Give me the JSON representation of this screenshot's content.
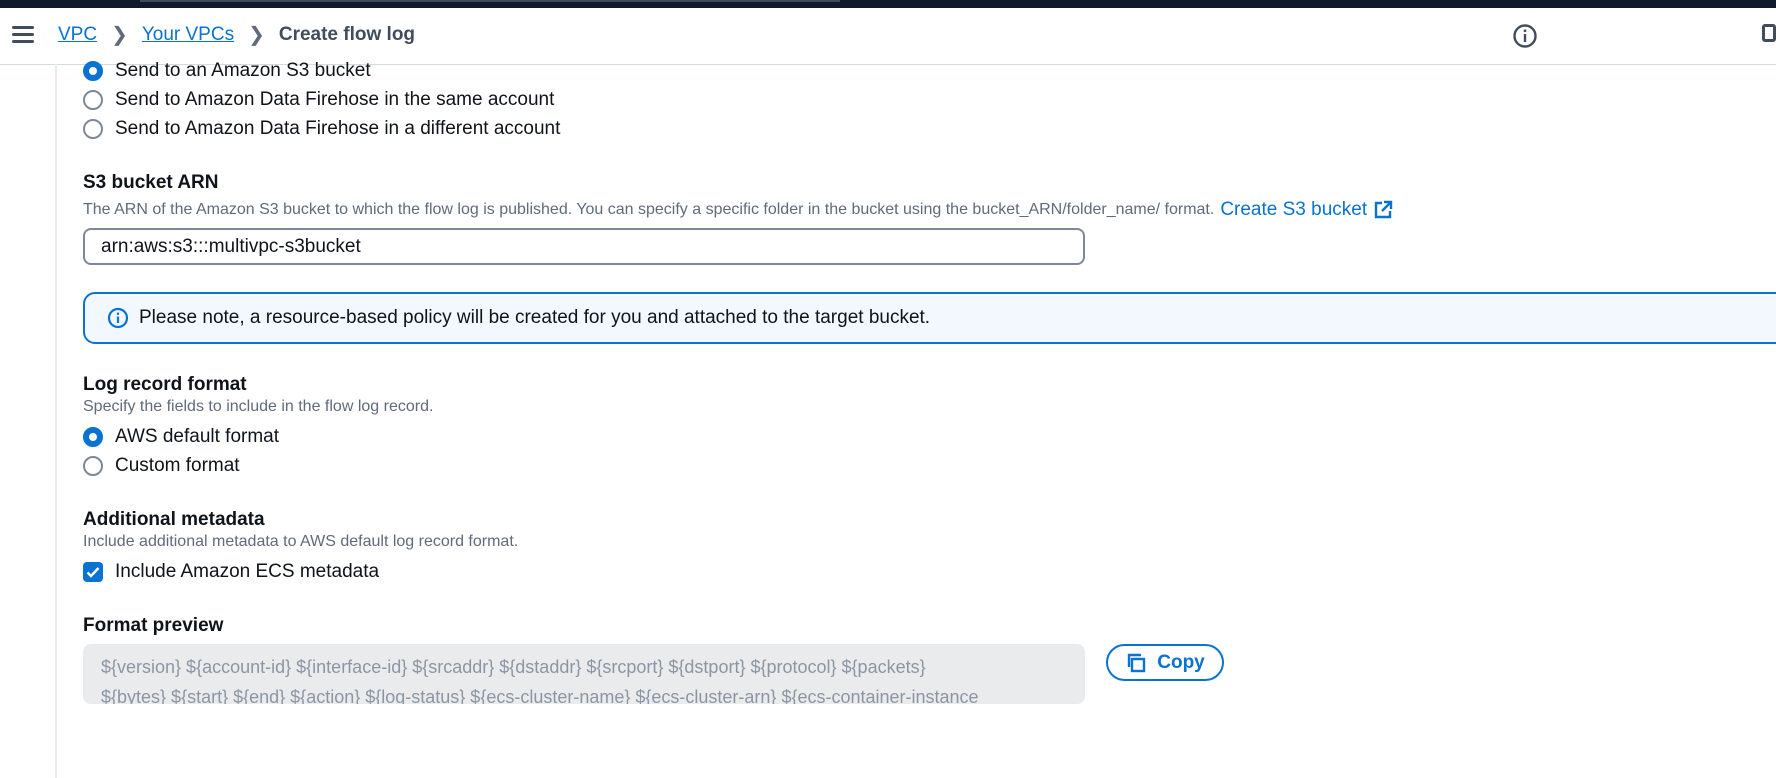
{
  "header": {
    "breadcrumb": [
      {
        "label": "VPC"
      },
      {
        "label": "Your VPCs"
      },
      {
        "label": "Create flow log"
      }
    ]
  },
  "destination": {
    "options": [
      {
        "label": "Send to an Amazon S3 bucket",
        "checked": true
      },
      {
        "label": "Send to Amazon Data Firehose in the same account",
        "checked": false
      },
      {
        "label": "Send to Amazon Data Firehose in a different account",
        "checked": false
      }
    ]
  },
  "s3_bucket": {
    "label": "S3 bucket ARN",
    "description": "The ARN of the Amazon S3 bucket to which the flow log is published. You can specify a specific folder in the bucket using the bucket_ARN/folder_name/ format.",
    "create_link": "Create S3 bucket",
    "value": "arn:aws:s3:::multivpc-s3bucket"
  },
  "alert": {
    "text": "Please note, a resource-based policy will be created for you and attached to the target bucket."
  },
  "log_format": {
    "label": "Log record format",
    "description": "Specify the fields to include in the flow log record.",
    "options": [
      {
        "label": "AWS default format",
        "checked": true
      },
      {
        "label": "Custom format",
        "checked": false
      }
    ]
  },
  "metadata": {
    "label": "Additional metadata",
    "description": "Include additional metadata to AWS default log record format.",
    "checkbox_label": "Include Amazon ECS metadata",
    "checked": true
  },
  "preview": {
    "label": "Format preview",
    "line1": "${version} ${account-id} ${interface-id} ${srcaddr} ${dstaddr} ${srcport} ${dstport} ${protocol} ${packets}",
    "line2": "${bytes} ${start} ${end} ${action} ${log-status} ${ecs-cluster-name} ${ecs-cluster-arn} ${ecs-container-instance",
    "copy_label": "Copy"
  },
  "colors": {
    "accent": "#0972d3",
    "header_dark": "#0f1b2a",
    "alert_bg": "#f2f8fd"
  }
}
